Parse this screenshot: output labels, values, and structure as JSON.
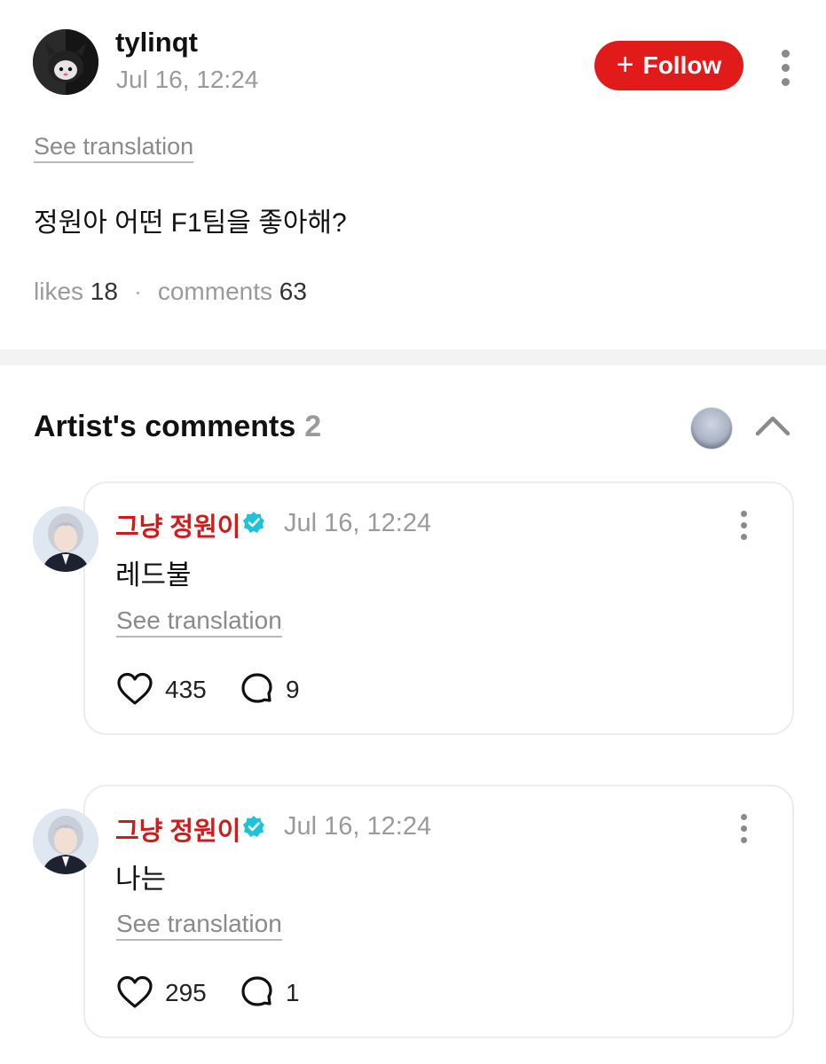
{
  "post": {
    "username": "tylinqt",
    "date": "Jul 16, 12:24",
    "follow_label": "Follow",
    "see_translation": "See translation",
    "body": "정원아 어떤 F1팀을 좋아해?",
    "likes_label": "likes",
    "likes_count": "18",
    "separator": "·",
    "comments_label": "comments",
    "comments_count": "63"
  },
  "artist_section": {
    "title": "Artist's comments",
    "count": "2"
  },
  "comments": [
    {
      "name": "그냥 정원이",
      "date": "Jul 16, 12:24",
      "body": "레드불",
      "see_translation": "See translation",
      "likes": "435",
      "replies": "9"
    },
    {
      "name": "그냥 정원이",
      "date": "Jul 16, 12:24",
      "body": "나는",
      "see_translation": "See translation",
      "likes": "295",
      "replies": "1"
    }
  ],
  "colors": {
    "accent": "#e11a1a",
    "name_red": "#d21a1a",
    "verified": "#1ec3d8",
    "muted": "#9a9a9a"
  }
}
